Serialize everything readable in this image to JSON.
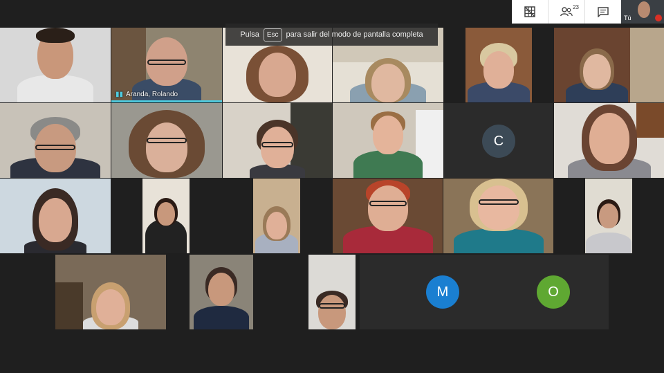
{
  "fullscreen_hint": {
    "prefix": "Pulsa",
    "key": "Esc",
    "suffix": "para salir del modo de pantalla completa"
  },
  "toolbar": {
    "grid_icon": "grid-off-icon",
    "participants_icon": "people-icon",
    "participants_count": "23",
    "chat_icon": "chat-icon",
    "self_label": "Tú"
  },
  "participants": [
    {
      "name": "Aranda, Rolando",
      "active": true
    }
  ],
  "avatars": [
    {
      "letter": "C",
      "color": "#3c4a56"
    },
    {
      "letter": "M",
      "color": "#1a7fd1"
    },
    {
      "letter": "O",
      "color": "#5fa832"
    }
  ]
}
